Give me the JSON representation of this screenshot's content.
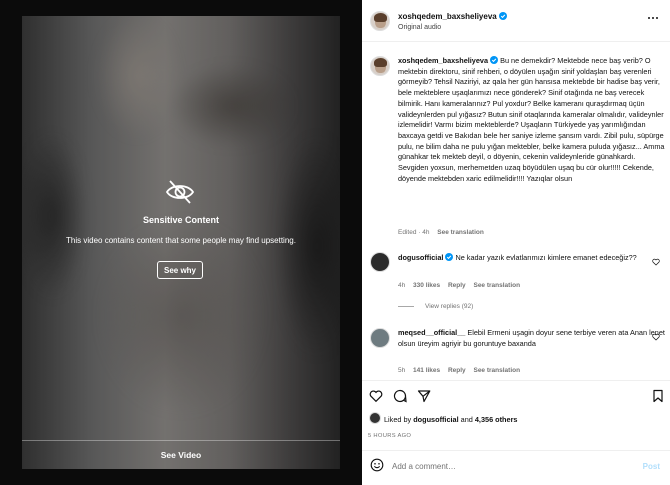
{
  "media": {
    "sensitive_title": "Sensitive Content",
    "sensitive_desc": "This video contains content that some people may find upsetting.",
    "see_why": "See why",
    "see_video": "See Video"
  },
  "header": {
    "username": "xoshqedem_baxsheliyeva",
    "audio": "Original audio"
  },
  "caption": {
    "username": "xoshqedem_baxsheliyeva",
    "text": "Bu ne demekdir? Mektebde nece baş verib? O mektebin direktoru, sinif rehberi, o döyülen uşağın sinif yoldaşları baş verenleri görmeyib? Tehsil Naziriyi, az qala her gün hansısa mektebde bir hadise baş verir, bele mekteblere uşaqlarımızı nece gönderek? Sinif otağında ne baş verecek bilmirik. Hanı kameralarınız? Pul yoxdur? Belke kameranı quraşdırmaq üçün valideynlerden pul yığasız? Butun sinif otaqlarında kameralar olmalıdır, valideynler izlemelidir! Varmı bizim mekteblerde? Uşaqların Türkiyede yaş yarımlığından baxcaya getdi ve Bakıdan bele her saniye izleme şansım vardı. Zibil pulu, süpürge pulu, ne bilim daha ne pulu yığan mektebler, belke kamera puluda yığasız... Amma günahkar tek mekteb deyil, o döyenin, cekenin valideynleride günahkardı. Sevgiden yoxsun, merhemetden uzaq böyüdülen uşaq bu cür olur!!!!! Cekende, döyende mektebden xaric edilmelidir!!!! Yazıqlar olsun",
    "age": "Edited · 4h",
    "see_translation": "See translation"
  },
  "comments": [
    {
      "username": "dogusofficial",
      "text": "Ne kadar yazık evlatlarımızı kimlere emanet edeceğiz??",
      "age": "4h",
      "likes": "330 likes",
      "reply": "Reply",
      "see_translation": "See translation",
      "view_replies": "View replies (92)"
    },
    {
      "username": "meqsed__official__",
      "text": "Elebil Ermeni uşagin doyur sene terbiye veren ata Anan lenet olsun üreyim agriyir bu goruntuye baxanda",
      "age": "5h",
      "likes": "141 likes",
      "reply": "Reply",
      "see_translation": "See translation"
    }
  ],
  "footer": {
    "liked_by_prefix": "Liked by",
    "liked_by_user": "dogusofficial",
    "liked_by_and": "and",
    "liked_by_count": "4,356 others",
    "time": "5 HOURS AGO",
    "add_comment_placeholder": "Add a comment…",
    "post_label": "Post"
  },
  "colors": {
    "verified": "#0095f6",
    "post_disabled": "#b2dffc"
  }
}
